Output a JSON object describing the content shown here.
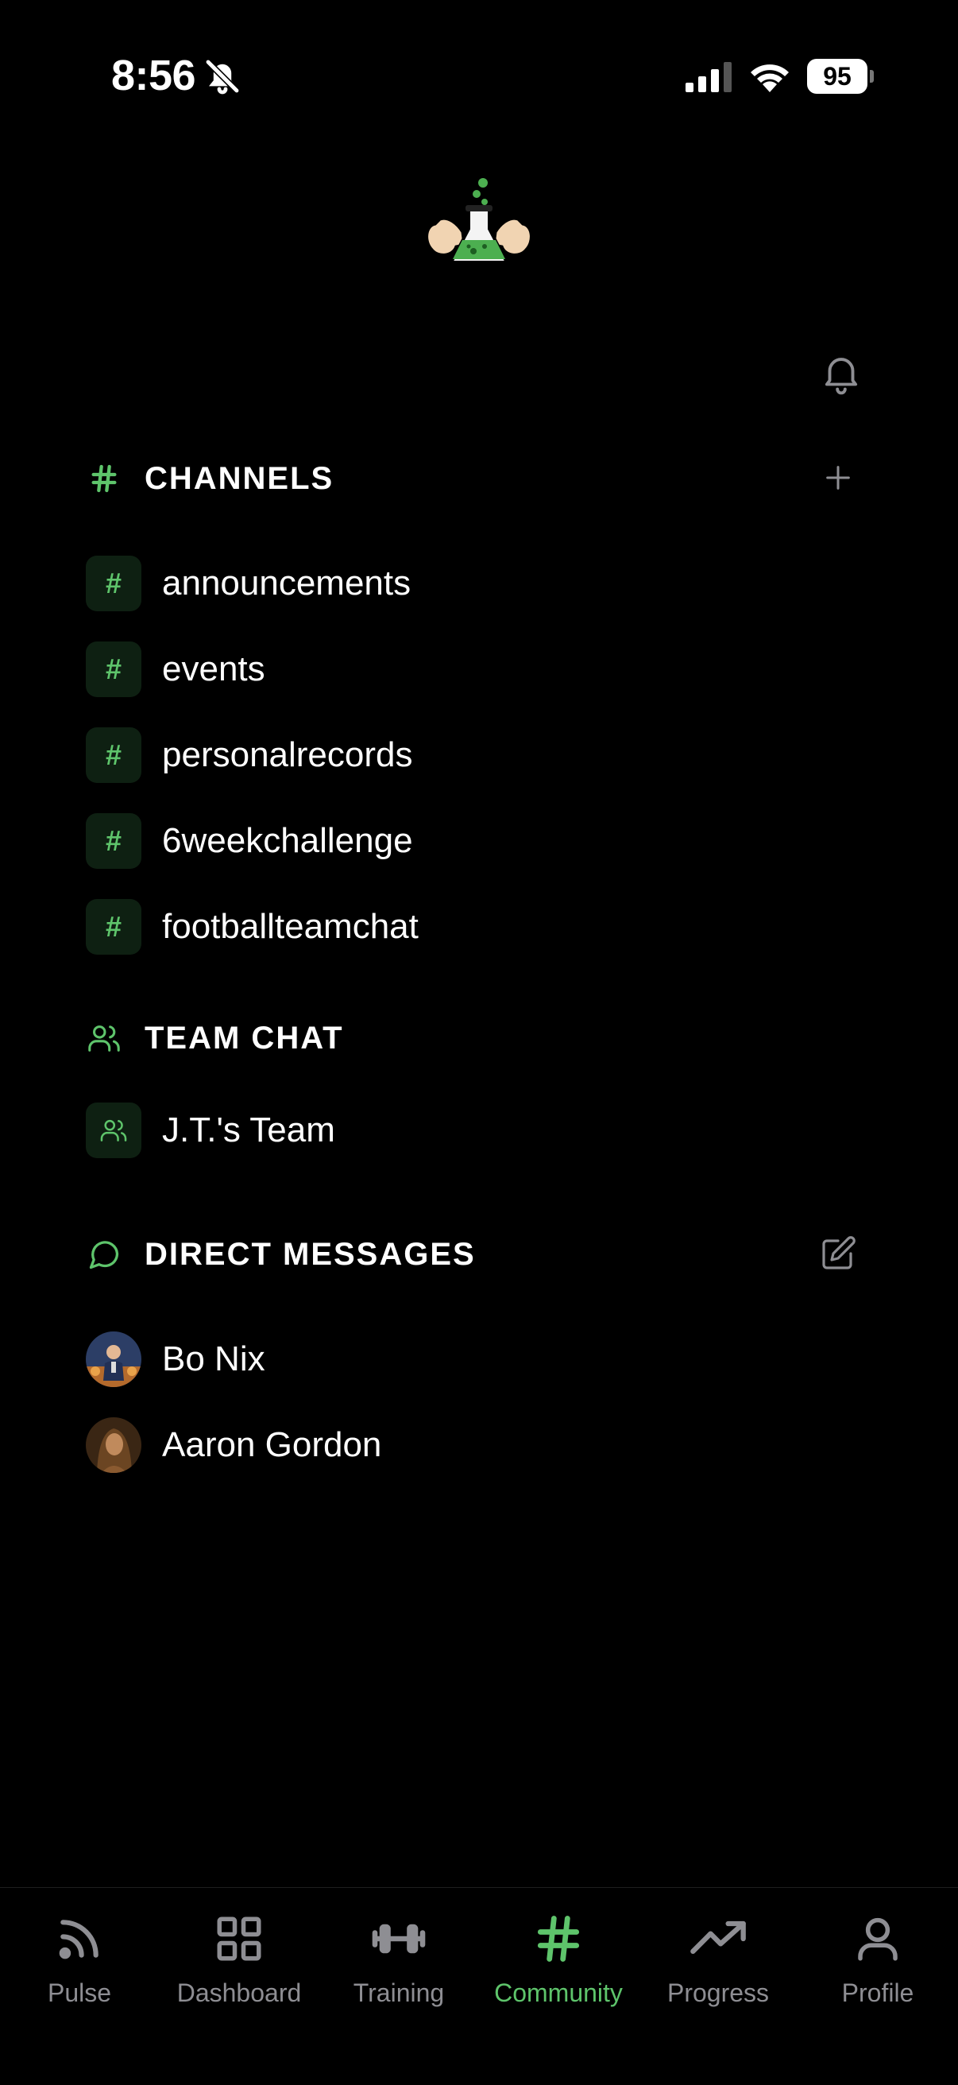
{
  "status_bar": {
    "time": "8:56",
    "battery": "95"
  },
  "channels": {
    "title": "CHANNELS",
    "items": [
      {
        "label": "announcements"
      },
      {
        "label": "events"
      },
      {
        "label": "personalrecords"
      },
      {
        "label": "6weekchallenge"
      },
      {
        "label": "footballteamchat"
      }
    ]
  },
  "team_chat": {
    "title": "TEAM CHAT",
    "items": [
      {
        "label": "J.T.'s Team"
      }
    ]
  },
  "direct_messages": {
    "title": "DIRECT MESSAGES",
    "items": [
      {
        "label": "Bo Nix"
      },
      {
        "label": "Aaron Gordon"
      }
    ]
  },
  "tabs": [
    {
      "label": "Pulse",
      "icon": "rss-icon"
    },
    {
      "label": "Dashboard",
      "icon": "grid-icon"
    },
    {
      "label": "Training",
      "icon": "dumbbell-icon"
    },
    {
      "label": "Community",
      "icon": "hash-icon",
      "active": true
    },
    {
      "label": "Progress",
      "icon": "trending-up-icon"
    },
    {
      "label": "Profile",
      "icon": "user-icon"
    }
  ],
  "colors": {
    "accent": "#5ec46b",
    "inactive": "#8e8e93",
    "background": "#000000"
  }
}
